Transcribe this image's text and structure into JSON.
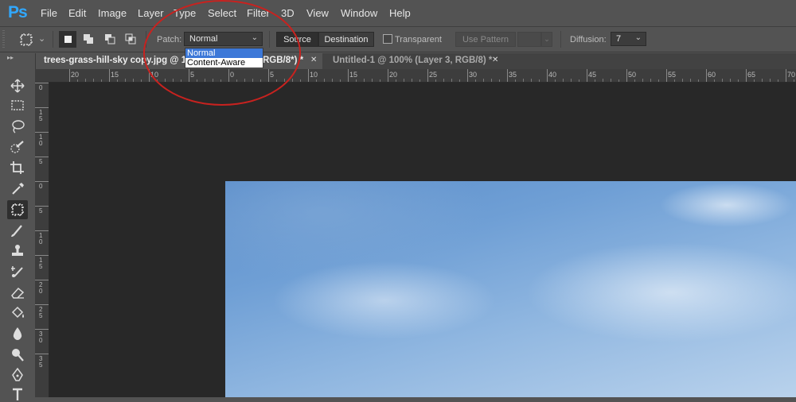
{
  "app": {
    "logo": "Ps"
  },
  "menu": [
    "File",
    "Edit",
    "Image",
    "Layer",
    "Type",
    "Select",
    "Filter",
    "3D",
    "View",
    "Window",
    "Help"
  ],
  "options": {
    "patch_label": "Patch:",
    "patch_value": "Normal",
    "patch_options": [
      "Normal",
      "Content-Aware"
    ],
    "source_button": "Source",
    "destination_button": "Destination",
    "transparent_label": "Transparent",
    "use_pattern_button": "Use Pattern",
    "diffusion_label": "Diffusion:",
    "diffusion_value": "7"
  },
  "tabs": [
    {
      "title": "trees-grass-hill-sky copy.jpg @ 10",
      "tail": "RGB/8*) *"
    },
    {
      "title": "Untitled-1 @ 100% (Layer 3, RGB/8) *"
    }
  ],
  "ruler_top": [
    "20",
    "15",
    "10",
    "5",
    "0",
    "5",
    "10",
    "15",
    "20",
    "25",
    "30",
    "35",
    "40",
    "45",
    "50",
    "55",
    "60",
    "65",
    "70"
  ],
  "ruler_left": [
    "0",
    "1 5",
    "1 0",
    "5",
    "0",
    "5",
    "1 0",
    "1 5",
    "2 0",
    "2 5",
    "3 0",
    "3 5"
  ],
  "colors": {
    "annotation": "#c8221f",
    "accent": "#31a8ff",
    "canvas": "#282828"
  }
}
